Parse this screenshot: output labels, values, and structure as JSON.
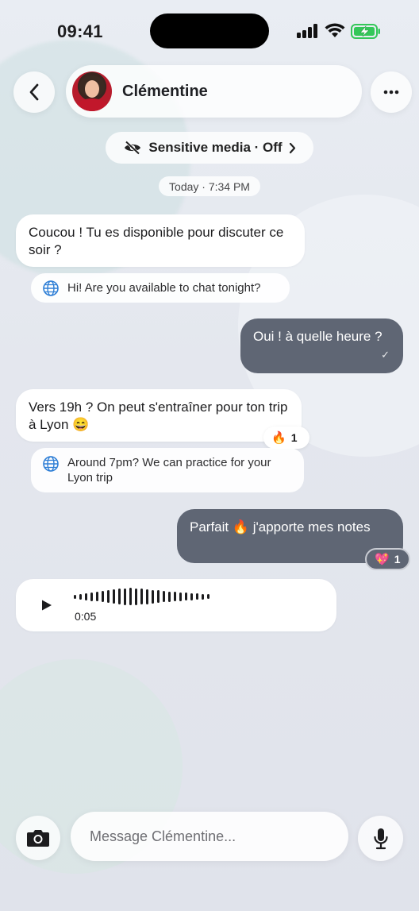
{
  "status_bar": {
    "time": "09:41"
  },
  "header": {
    "contact_name": "Clémentine",
    "back_icon": "chevron-left-icon",
    "more_icon": "ellipsis-icon"
  },
  "sensitive_media": {
    "label": "Sensitive media · Off",
    "icon": "eye-slash-icon"
  },
  "date_separator": "Today · 7:34 PM",
  "messages": [
    {
      "direction": "incoming",
      "text": "Coucou ! Tu es disponible pour discuter ce soir ?",
      "translation": "Hi! Are you available to chat tonight?"
    },
    {
      "direction": "outgoing",
      "text": "Oui ! à quelle heure ?",
      "status": "✓"
    },
    {
      "direction": "incoming",
      "text": "Vers 19h ? On peut s'entraîner pour ton trip à Lyon 😄",
      "translation": "Around 7pm? We can practice for your Lyon trip",
      "reaction": {
        "emoji": "🔥",
        "count": "1"
      }
    },
    {
      "direction": "outgoing",
      "text": "Parfait 🔥 j'apporte mes notes",
      "reaction": {
        "emoji": "💖",
        "count": "1"
      }
    },
    {
      "direction": "incoming",
      "type": "voice",
      "duration": "0:05"
    }
  ],
  "composer": {
    "placeholder": "Message Clémentine..."
  },
  "colors": {
    "outgoing_bubble": "#5f6674",
    "incoming_bubble": "#ffffff",
    "background": "#e6e9f0"
  }
}
